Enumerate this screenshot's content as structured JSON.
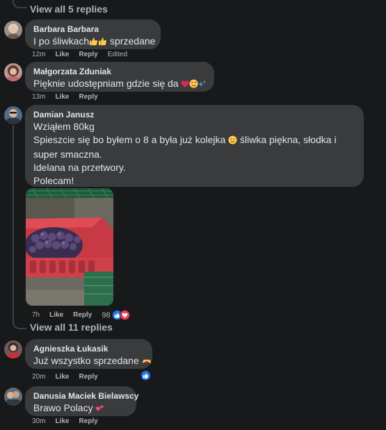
{
  "thread_top": {
    "view_replies": "View all 5 replies"
  },
  "comments": [
    {
      "author": "Barbara Barbara",
      "text": "I po śliwkach",
      "text_after": "sprzedane",
      "time": "12m",
      "like": "Like",
      "reply": "Reply",
      "edited": "Edited"
    },
    {
      "author": "Małgorzata Zduniak",
      "text": "Pięknie udostępniam gdzie się da",
      "time": "13m",
      "like": "Like",
      "reply": "Reply"
    },
    {
      "author": "Damian Janusz",
      "lines": [
        "Wziąłem 80kg",
        "Spieszcie się bo byłem o 8 a była już kolejka",
        "śliwka piękna, słodka i",
        "super smaczna.",
        "Idelana na przetwory.",
        "Polecam!"
      ],
      "time": "7h",
      "like": "Like",
      "reply": "Reply",
      "reaction_count": "98",
      "view_replies": "View all 11 replies"
    },
    {
      "author": "Agnieszka Łukasik",
      "text": "Już wszystko sprzedane",
      "time": "20m",
      "like": "Like",
      "reply": "Reply"
    },
    {
      "author": "Danusia Maciek Bielawscy",
      "text": "Brawo Polacy",
      "time": "30m",
      "like": "Like",
      "reply": "Reply"
    }
  ],
  "colors": {
    "background": "#18191a",
    "bubble": "#3a3b3c",
    "text": "#e4e6eb",
    "muted": "#b0b3b8",
    "like_blue": "#1877f2",
    "love_red": "#f33e58"
  },
  "icons": {
    "thumbs_up": "thumbs-up-icon",
    "heart": "heart-icon",
    "like_reaction": "like-reaction-icon",
    "love_reaction": "love-reaction-icon"
  }
}
